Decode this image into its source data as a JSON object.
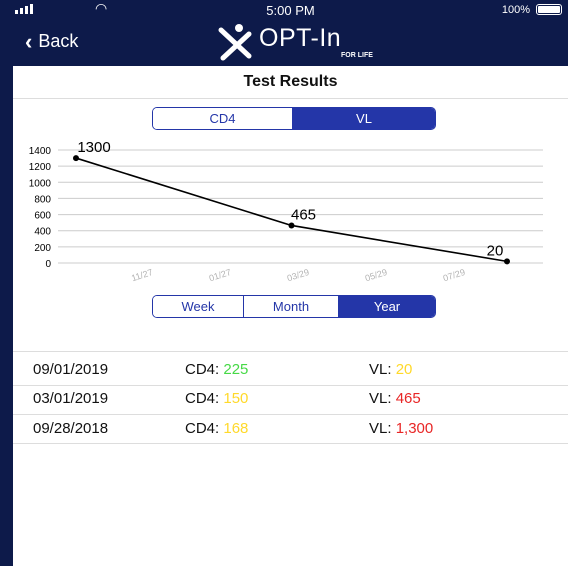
{
  "status": {
    "time": "5:00 PM",
    "battery": "100%"
  },
  "nav": {
    "back_label": "Back",
    "logo_text": "OPT-In",
    "logo_sub": "FOR LIFE"
  },
  "page": {
    "title": "Test Results"
  },
  "metric_tabs": {
    "items": [
      "CD4",
      "VL"
    ],
    "selected": "VL"
  },
  "range_tabs": {
    "items": [
      "Week",
      "Month",
      "Year"
    ],
    "selected": "Year"
  },
  "chart_data": {
    "type": "line",
    "x": [
      "09/28/2018",
      "03/01/2019",
      "09/01/2019"
    ],
    "values": [
      1300,
      465,
      20
    ],
    "data_labels": [
      "1300",
      "465",
      "20"
    ],
    "xticks": [
      "11/27",
      "01/27",
      "03/29",
      "05/29",
      "07/29"
    ],
    "yticks": [
      "0",
      "200",
      "400",
      "600",
      "800",
      "1000",
      "1200",
      "1400"
    ],
    "ylim": [
      0,
      1400
    ],
    "grid": true
  },
  "results": [
    {
      "date": "09/01/2019",
      "cd4_label": "CD4:",
      "cd4": "225",
      "cd4_color": "#46d946",
      "vl_label": "VL:",
      "vl": "20",
      "vl_color": "#ffd92a"
    },
    {
      "date": "03/01/2019",
      "cd4_label": "CD4:",
      "cd4": "150",
      "cd4_color": "#ffd92a",
      "vl_label": "VL:",
      "vl": "465",
      "vl_color": "#e82626"
    },
    {
      "date": "09/28/2018",
      "cd4_label": "CD4:",
      "cd4": "168",
      "cd4_color": "#ffd92a",
      "vl_label": "VL:",
      "vl": "1,300",
      "vl_color": "#e82626"
    }
  ],
  "colors": {
    "header_bg": "#0d1a4a",
    "accent": "#2436a8"
  }
}
